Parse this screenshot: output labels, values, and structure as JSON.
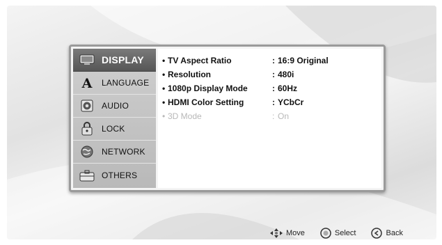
{
  "menu": {
    "items": [
      {
        "label": "DISPLAY",
        "icon": "tv-icon",
        "selected": true
      },
      {
        "label": "LANGUAGE",
        "icon": "letter-a-icon",
        "selected": false
      },
      {
        "label": "AUDIO",
        "icon": "speaker-icon",
        "selected": false
      },
      {
        "label": "LOCK",
        "icon": "padlock-icon",
        "selected": false
      },
      {
        "label": "NETWORK",
        "icon": "globe-icon",
        "selected": false
      },
      {
        "label": "OTHERS",
        "icon": "toolbox-icon",
        "selected": false
      }
    ]
  },
  "settings": [
    {
      "bullet": "•",
      "name": "TV Aspect Ratio",
      "colon": ":",
      "value": "16:9 Original",
      "enabled": true
    },
    {
      "bullet": "•",
      "name": "Resolution",
      "colon": ":",
      "value": "480i",
      "enabled": true
    },
    {
      "bullet": "•",
      "name": "1080p Display Mode",
      "colon": ":",
      "value": "60Hz",
      "enabled": true
    },
    {
      "bullet": "•",
      "name": "HDMI Color Setting",
      "colon": ":",
      "value": "YCbCr",
      "enabled": true
    },
    {
      "bullet": "•",
      "name": "3D Mode",
      "colon": ":",
      "value": "On",
      "enabled": false
    }
  ],
  "hints": {
    "move": {
      "label": "Move",
      "icon": "directional-arrows-icon"
    },
    "select": {
      "label": "Select",
      "icon": "enter-button-icon"
    },
    "back": {
      "label": "Back",
      "icon": "back-button-icon"
    }
  },
  "colors": {
    "selected_menu": "#666666",
    "menu_bg": "#c4c4c4",
    "panel_border": "#9a9a9a",
    "disabled_text": "#b8b8b8"
  }
}
